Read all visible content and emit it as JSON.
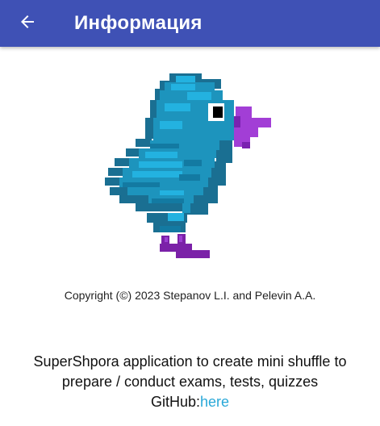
{
  "appbar": {
    "title": "Информация",
    "back_icon": "arrow-back-icon",
    "background_color": "#3f51b5"
  },
  "logo": {
    "icon": "pixel-bird-icon"
  },
  "copyright": "Copyright (©) 2023 Stepanov L.I. and Pelevin A.A.",
  "description": {
    "line1": "SuperShpora application to create mini shuffle to",
    "line2": "prepare / conduct exams, tests, quizzes",
    "github_prefix": "GitHub:",
    "github_link": "here",
    "link_color": "#29a8d8"
  }
}
